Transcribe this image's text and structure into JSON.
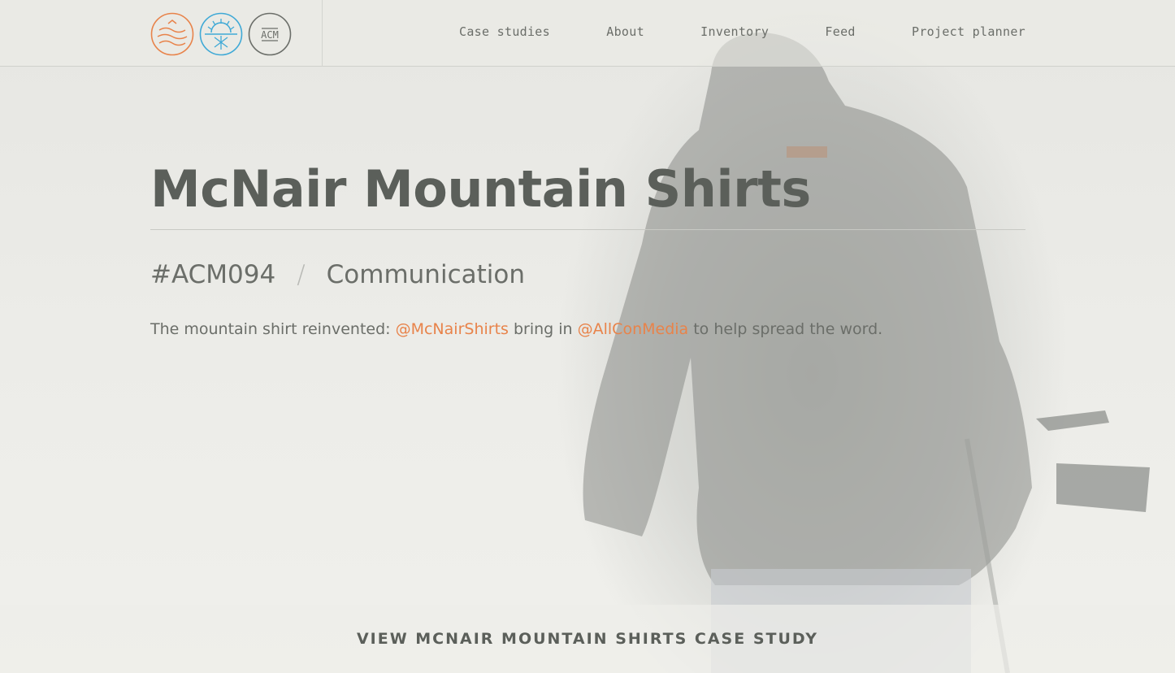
{
  "brand": {
    "logo_text": "ACM",
    "colors": {
      "orange": "#e8834a",
      "blue": "#3fa9d6",
      "gray": "#6b6e69"
    },
    "logo_icons": [
      "waves-logo-icon",
      "sun-snowflake-logo-icon",
      "acm-logo-icon"
    ]
  },
  "nav": {
    "items": [
      {
        "label": "Case studies"
      },
      {
        "label": "About"
      },
      {
        "label": "Inventory"
      },
      {
        "label": "Feed"
      },
      {
        "label": "Project planner"
      }
    ]
  },
  "hero": {
    "title": "McNair Mountain Shirts",
    "code": "#ACM094",
    "separator": "/",
    "category": "Communication",
    "desc_prefix": "The mountain shirt reinvented: ",
    "mention1": "@McNairShirts",
    "desc_middle": " bring in ",
    "mention2": "@AllConMedia",
    "desc_suffix": " to help spread the word."
  },
  "cta": {
    "label": "VIEW MCNAIR MOUNTAIN SHIRTS CASE STUDY"
  }
}
